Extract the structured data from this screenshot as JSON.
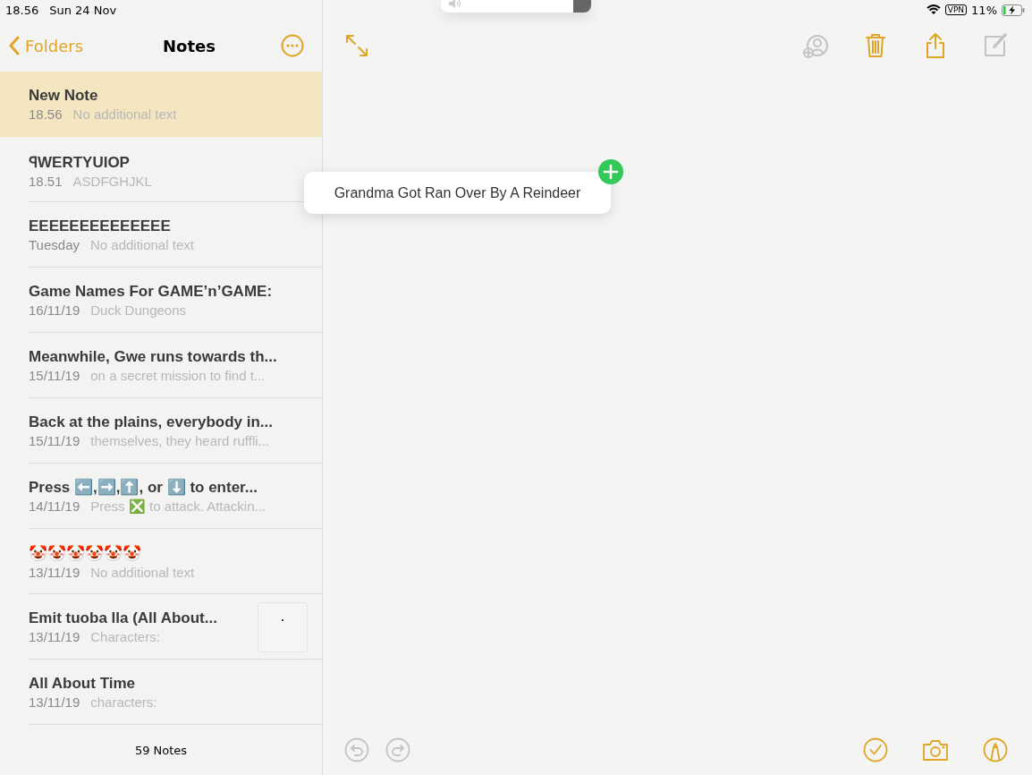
{
  "status_bar": {
    "time": "18.56",
    "date": "Sun 24 Nov",
    "vpn": "VPN",
    "battery": "11%"
  },
  "sidebar": {
    "back": "Folders",
    "title": "Notes",
    "notes": [
      {
        "title": "New Note",
        "date": "18.56",
        "preview": "No additional text",
        "selected": true,
        "thumbnail": false
      },
      {
        "title": "ꟼWERTYUIOP",
        "date": "18.51",
        "preview": "ASDFGHJKL",
        "selected": false,
        "thumbnail": false
      },
      {
        "title": "EEEEEEEEEEEEEE",
        "date": "Tuesday",
        "preview": "No additional text",
        "selected": false,
        "thumbnail": false
      },
      {
        "title": "Game Names For GAME’n’GAME:",
        "date": "16/11/19",
        "preview": "Duck Dungeons",
        "selected": false,
        "thumbnail": false
      },
      {
        "title": "Meanwhile, Gwe runs towards th...",
        "date": "15/11/19",
        "preview": "on a secret mission to find t...",
        "selected": false,
        "thumbnail": false
      },
      {
        "title": "Back at the plains, everybody in...",
        "date": "15/11/19",
        "preview": "themselves, they heard ruffli...",
        "selected": false,
        "thumbnail": false
      },
      {
        "title": "Press ⬅️,➡️,⬆️, or ⬇️ to enter...",
        "date": "14/11/19",
        "preview": "Press ❎ to attack. Attackin...",
        "selected": false,
        "thumbnail": false
      },
      {
        "title": "🤡🤡🤡🤡🤡🤡",
        "date": "13/11/19",
        "preview": "No additional text",
        "selected": false,
        "thumbnail": false
      },
      {
        "title": "Emit tuoba lla (All About...",
        "date": "13/11/19",
        "preview": "Characters:",
        "selected": false,
        "thumbnail": true
      },
      {
        "title": "All About Time",
        "date": "13/11/19",
        "preview": "characters:",
        "selected": false,
        "thumbnail": false
      }
    ],
    "count": "59 Notes"
  },
  "editor": {
    "top_tools": [
      {
        "kind": "expand",
        "disabled": false
      },
      {
        "kind": "collaborate",
        "disabled": true
      },
      {
        "kind": "trash",
        "disabled": false
      },
      {
        "kind": "share",
        "disabled": false
      },
      {
        "kind": "compose",
        "disabled": true
      }
    ],
    "bottom_tools": [
      {
        "kind": "undo",
        "disabled": true
      },
      {
        "kind": "redo",
        "disabled": true
      },
      {
        "kind": "checklist",
        "disabled": false
      },
      {
        "kind": "camera",
        "disabled": false
      },
      {
        "kind": "markup",
        "disabled": false
      }
    ],
    "suggestion": {
      "text": "Grandma Got Ran Over By A Reindeer"
    }
  }
}
